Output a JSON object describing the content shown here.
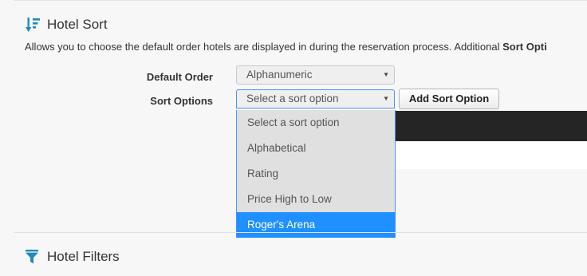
{
  "hotel_sort": {
    "title": "Hotel Sort",
    "icon": "sort-descending-icon",
    "description_text": "Allows you to choose the default order hotels are displayed in during the reservation process. Additional ",
    "description_bold": "Sort Opti"
  },
  "default_order": {
    "label": "Default Order",
    "selected": "Alphanumeric"
  },
  "sort_options": {
    "label": "Sort Options",
    "selected": "Select a sort option",
    "options": [
      "Select a sort option",
      "Alphabetical",
      "Rating",
      "Price High to Low",
      "Roger's Arena"
    ],
    "highlighted_index": 4,
    "add_button_label": "Add Sort Option"
  },
  "hotel_filters": {
    "title": "Hotel Filters",
    "icon": "filter-icon"
  },
  "colors": {
    "accent": "#1e90ff",
    "icon": "#1f8bb5",
    "focus_border": "#4d90fe"
  }
}
